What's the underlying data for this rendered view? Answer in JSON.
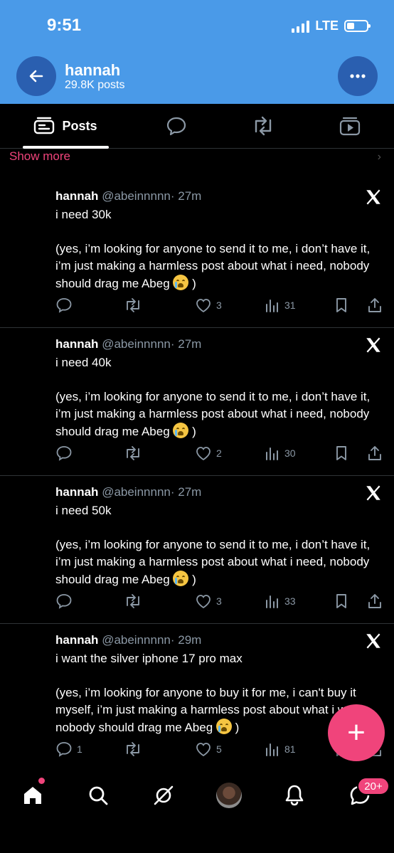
{
  "status_bar": {
    "time": "9:51",
    "network": "LTE"
  },
  "header": {
    "name": "hannah",
    "post_count": "29.8K posts"
  },
  "tabs": [
    {
      "label": "Posts",
      "icon": "posts-icon",
      "active": true
    },
    {
      "label": "",
      "icon": "replies-icon"
    },
    {
      "label": "",
      "icon": "reposts-icon"
    },
    {
      "label": "",
      "icon": "media-icon"
    }
  ],
  "show_more": "Show more",
  "posts": [
    {
      "name": "hannah",
      "handle": "@abeinnnnn",
      "time": "· 27m",
      "text": "i need 30k\n\n(yes, i’m looking for anyone to send it to me, i don’t have it, i’m just making a harmless post about what i need, nobody should drag me Abeg",
      "text_end": " )",
      "replies": "",
      "likes": "3",
      "views": "31"
    },
    {
      "name": "hannah",
      "handle": "@abeinnnnn",
      "time": "· 27m",
      "text": "i need 40k\n\n(yes, i’m looking for anyone to send it to me, i don’t have it, i’m just making a harmless post about what i need, nobody should drag me Abeg",
      "text_end": " )",
      "replies": "",
      "likes": "2",
      "views": "30"
    },
    {
      "name": "hannah",
      "handle": "@abeinnnnn",
      "time": "· 27m",
      "text": "i need 50k\n\n(yes, i’m looking for anyone to send it to me, i don’t have it, i’m just making a harmless post about what i need, nobody should drag me Abeg",
      "text_end": " )",
      "replies": "",
      "likes": "3",
      "views": "33"
    },
    {
      "name": "hannah",
      "handle": "@abeinnnnn",
      "time": "· 29m",
      "text": "i want the silver iphone 17 pro max\n\n(yes, i’m looking for anyone to buy it for me, i can't buy it myself, i’m just making a harmless post about what i want, nobody should drag me Abeg",
      "text_end": " )",
      "replies": "1",
      "likes": "5",
      "views": "81"
    }
  ],
  "fab": {
    "label": "+"
  },
  "bottom_nav": {
    "messages_badge": "20+"
  },
  "colors": {
    "header_bg": "#4a9ae8",
    "accent_pink": "#f0447b",
    "background": "#000000",
    "muted": "#8b98a5"
  }
}
